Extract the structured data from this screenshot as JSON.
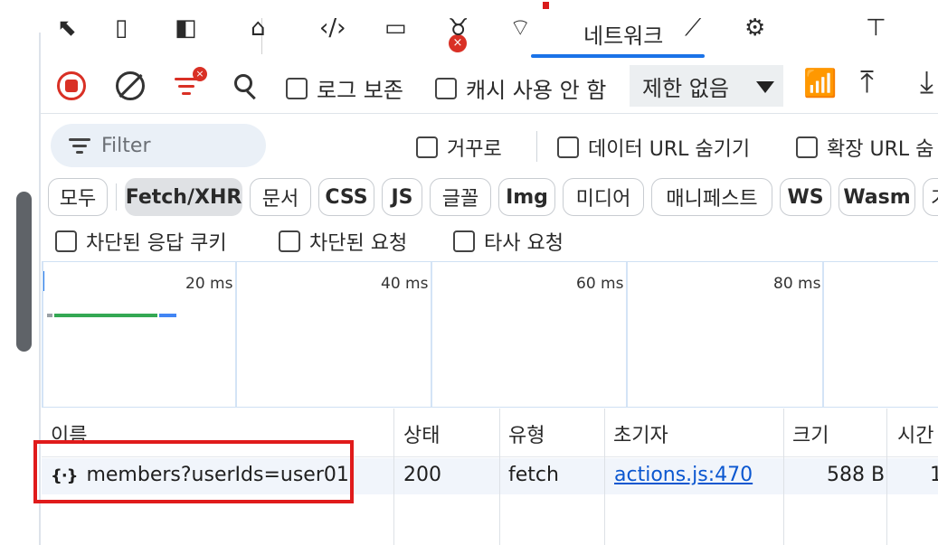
{
  "tabs": {
    "active_label": "네트워크",
    "issue_count": "×"
  },
  "toolbar": {
    "preserve_log": "로그 보존",
    "disable_cache": "캐시 사용 안 함",
    "throttling": "제한 없음"
  },
  "filter": {
    "placeholder": "Filter",
    "invert": "거꾸로",
    "hide_data_urls": "데이터 URL 숨기기",
    "hide_extension_urls": "확장 URL 숨"
  },
  "type_filters": [
    "모두",
    "Fetch/XHR",
    "문서",
    "CSS",
    "JS",
    "글꼴",
    "Img",
    "미디어",
    "매니페스트",
    "WS",
    "Wasm",
    "기"
  ],
  "more_filters": {
    "blocked_cookies": "차단된 응답 쿠키",
    "blocked_requests": "차단된 요청",
    "third_party": "타사 요청"
  },
  "overview": {
    "ticks": [
      "20 ms",
      "40 ms",
      "60 ms",
      "80 ms"
    ],
    "colors": {
      "waiting": "#34a853",
      "download": "#4285f4",
      "queue": "#9aa0a6"
    }
  },
  "table": {
    "headers": [
      "이름",
      "상태",
      "유형",
      "초기자",
      "크기",
      "시간"
    ],
    "rows": [
      {
        "icon": "{·}",
        "name": "members?userIds=user01",
        "status": "200",
        "type": "fetch",
        "initiator": "actions.js:470",
        "size": "588 B",
        "time": "1"
      }
    ]
  }
}
